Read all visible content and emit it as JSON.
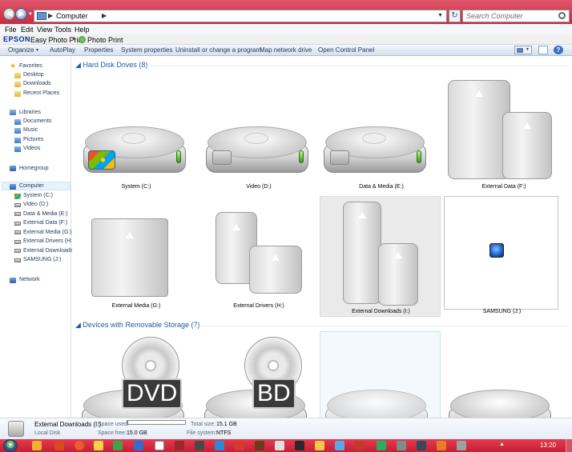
{
  "address": {
    "path": "Computer",
    "search_placeholder": "Search Computer"
  },
  "menu": [
    "File",
    "Edit",
    "View",
    "Tools",
    "Help"
  ],
  "epson": {
    "logo": "EPSON",
    "easy_photo_print": "Easy Photo Print",
    "photo_print": "Photo Print"
  },
  "commands": [
    "Organize",
    "AutoPlay",
    "Properties",
    "System properties",
    "Uninstall or change a program",
    "Map network drive",
    "Open Control Panel"
  ],
  "nav": {
    "favorites": {
      "label": "Favorites",
      "items": [
        "Desktop",
        "Downloads",
        "Recent Places"
      ]
    },
    "libraries": {
      "label": "Libraries",
      "items": [
        "Documents",
        "Music",
        "Pictures",
        "Videos"
      ]
    },
    "homegroup": "Homegroup",
    "computer": {
      "label": "Computer",
      "items": [
        "System (C:)",
        "Video (D:)",
        "Data & Media (E:)",
        "External Data (F:)",
        "External Media (G:)",
        "External Drivers (H:)",
        "External Downloads",
        "SAMSUNG (J:)"
      ]
    },
    "network": "Network"
  },
  "groups": {
    "hdd": {
      "header": "Hard Disk Drives (8)"
    },
    "removable": {
      "header": "Devices with Removable Storage (7)"
    }
  },
  "drives": [
    "System (C:)",
    "Video (D:)",
    "Data & Media (E:)",
    "External Data (F:)",
    "External Media (G:)",
    "External Drivers (H:)",
    "External Downloads (I:)",
    "SAMSUNG (J:)"
  ],
  "removable": [
    {
      "badge": "DVD"
    },
    {
      "badge": "BD"
    }
  ],
  "details": {
    "name": "External Downloads (I:)",
    "type": "Local Disk",
    "space_used_label": "Space used:",
    "space_used_fraction": 0.02,
    "space_free_label": "Space free:",
    "space_free": "15.0 GB",
    "total_size_label": "Total size:",
    "total_size": "15.1 GB",
    "fs_label": "File system:",
    "fs": "NTFS"
  },
  "taskbar": {
    "clock": "13:20"
  },
  "colors": {
    "titlebar": "#d23a4f",
    "taskbar": "#c51f33",
    "group_header": "#1e5aa8"
  }
}
